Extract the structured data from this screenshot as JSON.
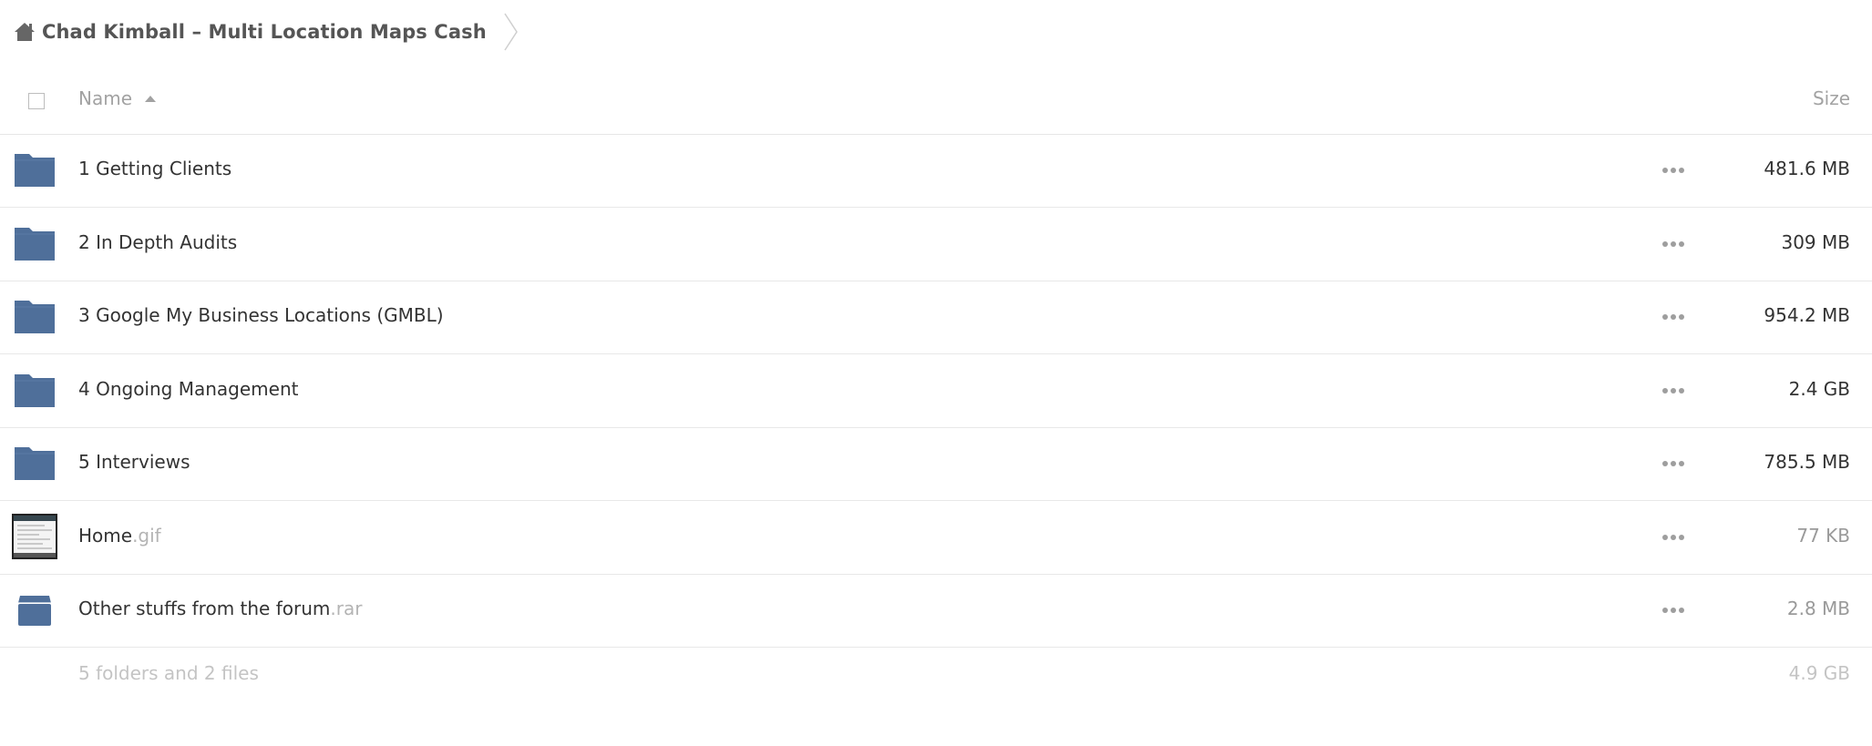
{
  "breadcrumb": {
    "home_icon": "home-icon",
    "title": "Chad Kimball – Multi Location Maps Cash"
  },
  "header": {
    "name_label": "Name",
    "size_label": "Size",
    "sort": "ascending"
  },
  "colors": {
    "folder": "#4f6f9a",
    "accent_text": "#333333",
    "muted": "#a2a2a2"
  },
  "rows": [
    {
      "type": "folder",
      "icon": "folder-icon",
      "name": "1 Getting Clients",
      "ext": "",
      "size": "481.6 MB"
    },
    {
      "type": "folder",
      "icon": "folder-icon",
      "name": "2 In Depth Audits",
      "ext": "",
      "size": "309 MB"
    },
    {
      "type": "folder",
      "icon": "folder-icon",
      "name": "3 Google My Business Locations (GMBL)",
      "ext": "",
      "size": "954.2 MB"
    },
    {
      "type": "folder",
      "icon": "folder-icon",
      "name": "4 Ongoing Management",
      "ext": "",
      "size": "2.4 GB"
    },
    {
      "type": "folder",
      "icon": "folder-icon",
      "name": "5 Interviews",
      "ext": "",
      "size": "785.5 MB"
    },
    {
      "type": "image",
      "icon": "image-thumbnail-icon",
      "name": "Home",
      "ext": ".gif",
      "size": "77 KB"
    },
    {
      "type": "archive",
      "icon": "archive-icon",
      "name": "Other stuffs from the forum",
      "ext": ".rar",
      "size": "2.8 MB"
    }
  ],
  "summary": {
    "text": "5 folders and 2 files",
    "total": "4.9 GB"
  }
}
